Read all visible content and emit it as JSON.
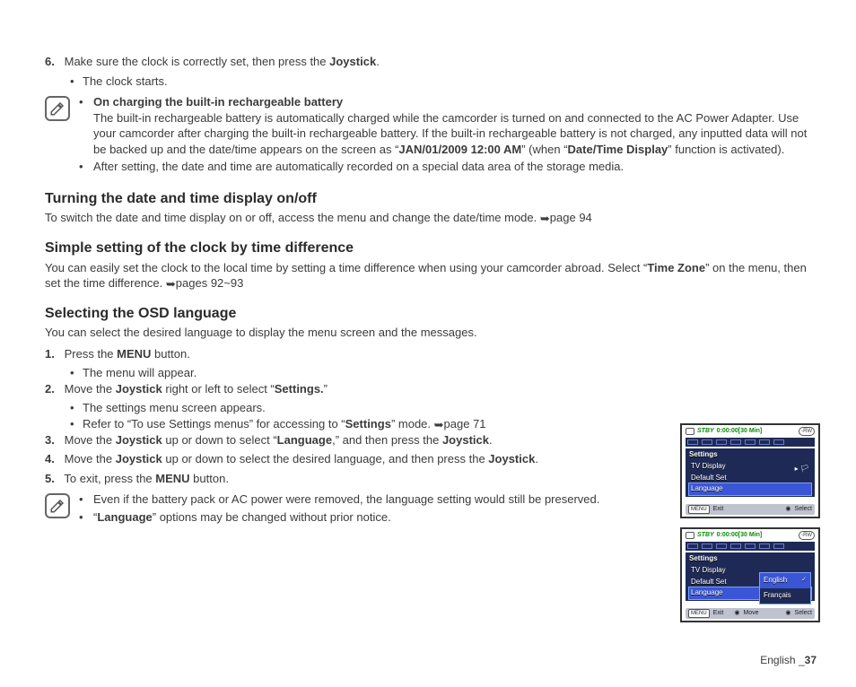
{
  "step6": {
    "num": "6.",
    "text_a": "Make sure the clock is correctly set, then press the ",
    "joystick": "Joystick",
    "text_b": ".",
    "sub": "The clock starts."
  },
  "note1": {
    "b1_title": "On charging the built-in rechargeable battery",
    "b1_body_a": "The built-in rechargeable battery is automatically charged while the camcorder is turned on and connected to the AC Power Adapter. Use your camcorder after charging the built-in rechargeable battery. If the built-in rechargeable battery is not charged, any inputted data will not be backed up and the date/time appears on the screen as “",
    "b1_bold1": "JAN/01/2009 12:00 AM",
    "b1_body_b": "” (when “",
    "b1_bold2": "Date/Time Display",
    "b1_body_c": "” function is activated).",
    "b2": "After setting, the date and time are automatically recorded on a special data area of the storage media."
  },
  "secA": {
    "title": "Turning the date and time display on/off",
    "body": "To switch the date and time display on or off, access the menu and change the date/time mode. ",
    "ref": "page 94"
  },
  "secB": {
    "title": "Simple setting of the clock by time difference",
    "body_a": "You can easily set the clock to the local time by setting a time difference when using your camcorder abroad. Select “",
    "bold": "Time Zone",
    "body_b": "” on the menu, then set the time difference. ",
    "ref": "pages 92~93"
  },
  "secC": {
    "title": "Selecting the OSD language",
    "intro": "You can select the desired language to display the menu screen and the messages.",
    "s1": {
      "num": "1.",
      "a": "Press the ",
      "b": "MENU",
      "c": " button.",
      "sub": "The menu will appear."
    },
    "s2": {
      "num": "2.",
      "a": "Move the ",
      "b": "Joystick",
      "c": " right or left to select “",
      "d": "Settings.",
      "e": "”",
      "sub1": "The settings menu screen appears.",
      "sub2_a": "Refer to “To use Settings menus” for accessing to “",
      "sub2_b": "Settings",
      "sub2_c": "” mode. ",
      "sub2_ref": "page 71"
    },
    "s3": {
      "num": "3.",
      "a": "Move the ",
      "b": "Joystick",
      "c": " up or down to select “",
      "d": "Language",
      "e": ",” and then press the ",
      "f": "Joystick",
      "g": "."
    },
    "s4": {
      "num": "4.",
      "a": "Move the ",
      "b": "Joystick",
      "c": " up or down to select the desired language, and then press the ",
      "d": "Joystick",
      "e": "."
    },
    "s5": {
      "num": "5.",
      "a": "To exit, press the ",
      "b": "MENU",
      "c": " button."
    }
  },
  "note2": {
    "b1": "Even if the battery pack or AC power were removed, the language setting would still be preserved.",
    "b2_a": "“",
    "b2_b": "Language",
    "b2_c": "” options may be changed without prior notice."
  },
  "screen": {
    "stby": "STBY",
    "tcode": "0:00:00[30 Min]",
    "rw": "-RW",
    "settings": "Settings",
    "tv": "TV Display",
    "def": "Default Set",
    "lang": "Language",
    "menu": "MENU",
    "exit": "Exit",
    "select": "Select",
    "move": "Move",
    "opt1": "English",
    "opt2": "Français"
  },
  "footer": {
    "lang": "English ",
    "sep": "_",
    "page": "37"
  },
  "glyph": {
    "arrow": "➥"
  }
}
